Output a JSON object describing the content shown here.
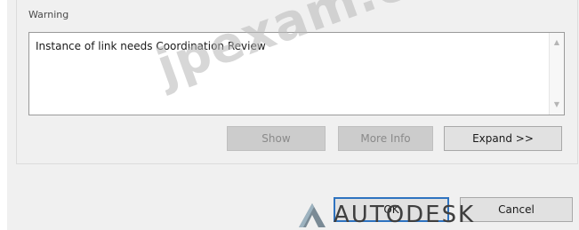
{
  "warning": {
    "label": "Warning",
    "message": "Instance of link needs Coordination Review"
  },
  "buttons": {
    "show": "Show",
    "more_info": "More Info",
    "expand": "Expand >>",
    "ok": "OK",
    "cancel": "Cancel"
  },
  "watermark": "jpexam.com",
  "brand": "AUTODESK",
  "colors": {
    "default_button_border": "#2e73c0",
    "disabled_button": "#cccccc",
    "dialog_background": "#f0f0f0"
  }
}
